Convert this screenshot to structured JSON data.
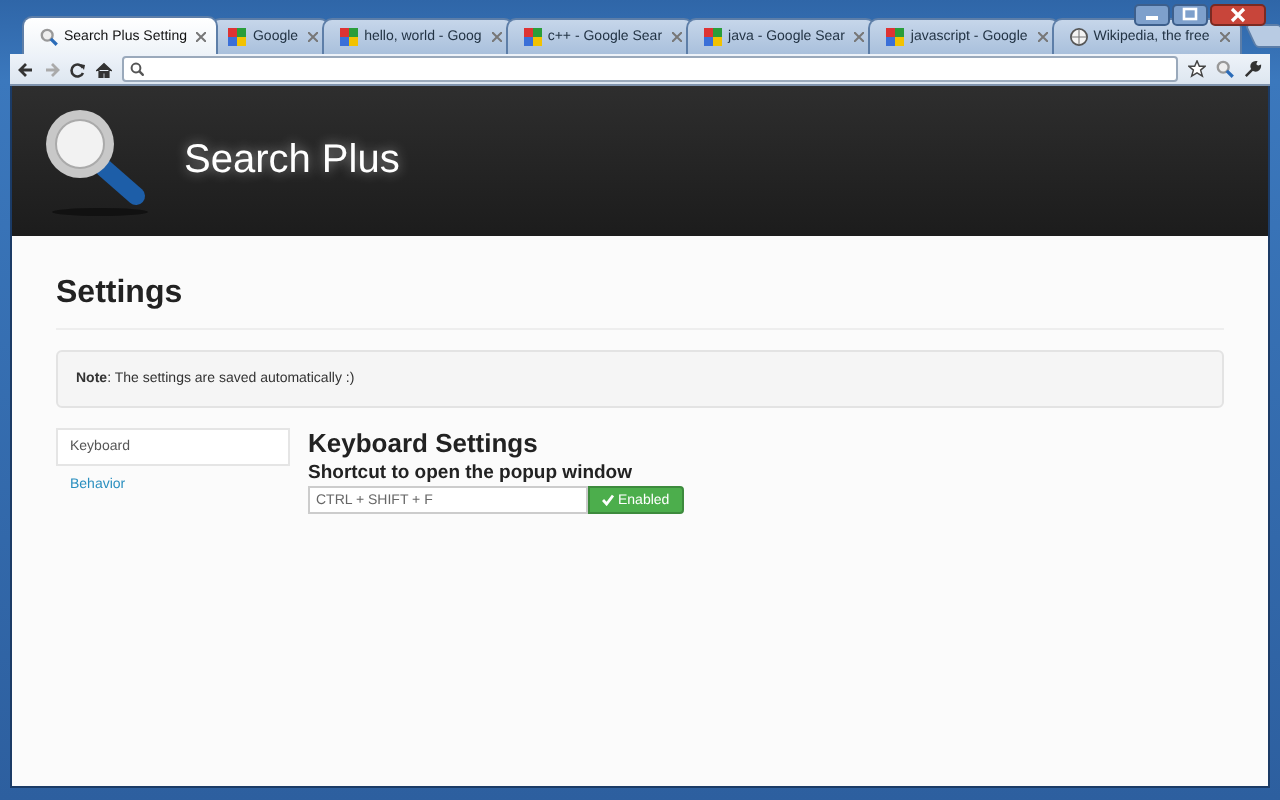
{
  "tabs": [
    {
      "title": "Search Plus Setting",
      "kind": "search",
      "selected": true
    },
    {
      "title": "Google",
      "kind": "google",
      "selected": false
    },
    {
      "title": "hello, world - Goog",
      "kind": "google",
      "selected": false
    },
    {
      "title": "c++ - Google Sear",
      "kind": "google",
      "selected": false
    },
    {
      "title": "java - Google Sear",
      "kind": "google",
      "selected": false
    },
    {
      "title": "javascript - Google",
      "kind": "google",
      "selected": false
    },
    {
      "title": "Wikipedia, the free",
      "kind": "wikipedia",
      "selected": false
    }
  ],
  "header": {
    "title": "Search Plus"
  },
  "page": {
    "heading": "Settings",
    "note": "**Note**: The settings are saved automatically :)"
  },
  "sidebar": {
    "items": [
      {
        "label": "Keyboard",
        "selected": true
      },
      {
        "label": "Behavior",
        "selected": false
      }
    ]
  },
  "keyboard": {
    "title": "Keyboard Settings",
    "label": "Shortcut to open the popup window",
    "value": "CTRL + SHIFT + F",
    "button": {
      "label": "Enabled",
      "enabled": true
    }
  }
}
